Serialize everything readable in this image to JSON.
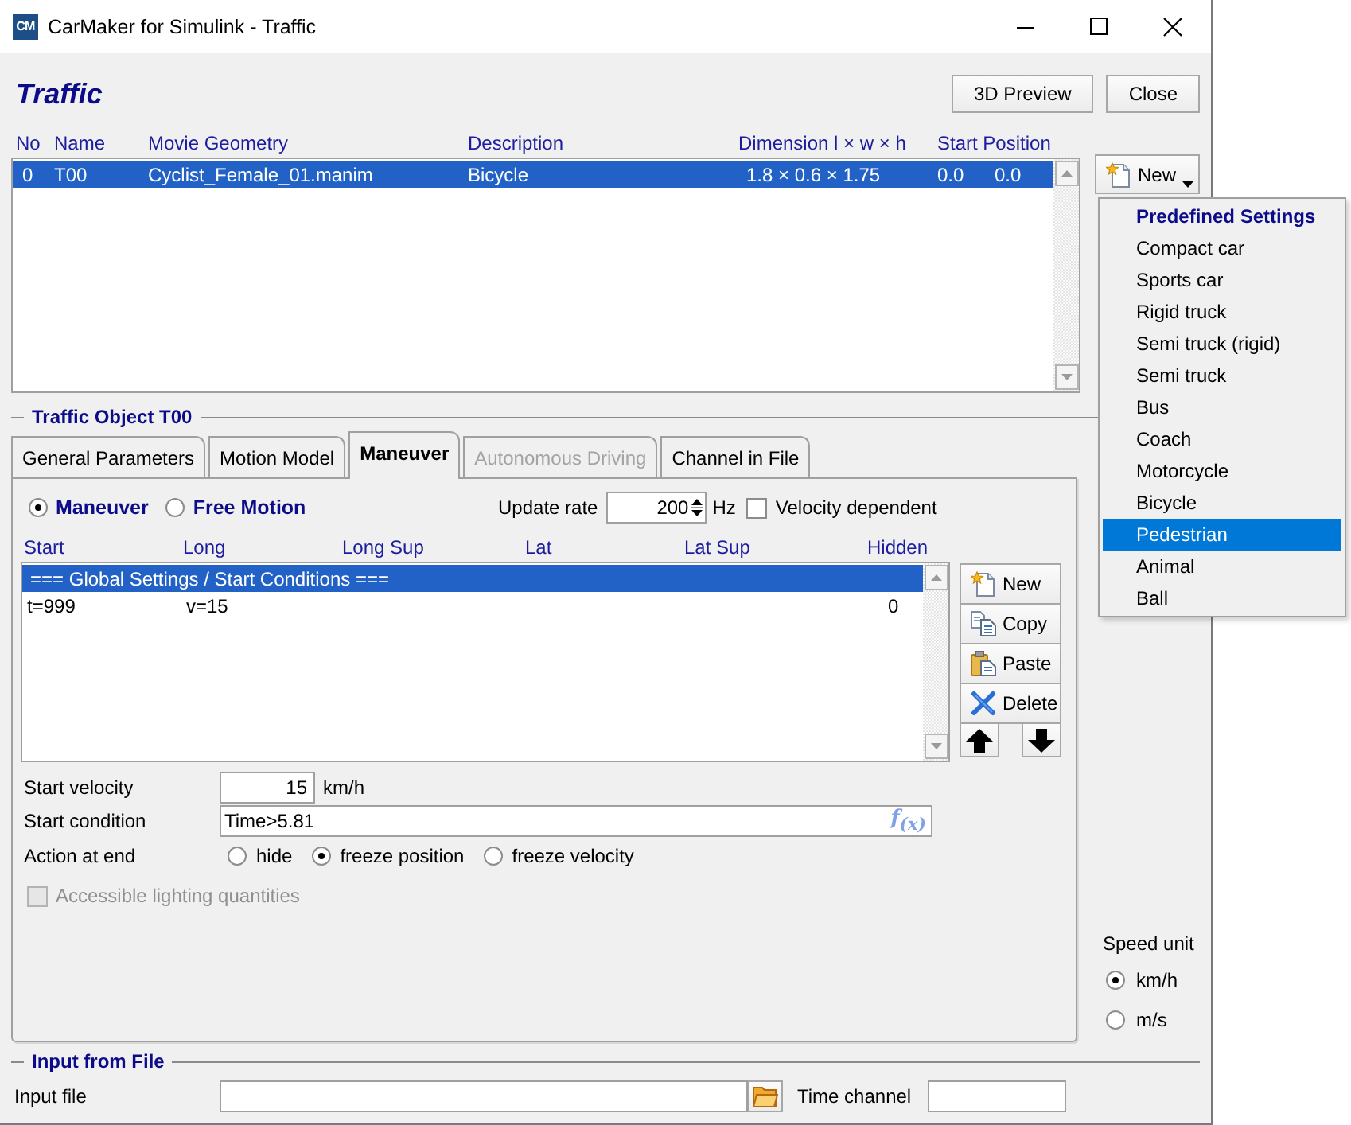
{
  "window": {
    "title": "CarMaker for Simulink - Traffic",
    "logo_text": "CM"
  },
  "header": {
    "title": "Traffic",
    "buttons": [
      {
        "label": "3D Preview"
      },
      {
        "label": "Close"
      }
    ]
  },
  "traffic_table": {
    "columns": [
      "No",
      "Name",
      "Movie Geometry",
      "Description",
      "Dimension l × w × h",
      "Start Position"
    ],
    "rows": [
      {
        "cells": [
          "0",
          "T00",
          "Cyclist_Female_01.manim",
          "Bicycle",
          "1.8 × 0.6 × 1.75",
          "0.0",
          "0.0"
        ],
        "selected": true
      }
    ]
  },
  "new_button": {
    "label": "New"
  },
  "new_menu": {
    "heading": "Predefined Settings",
    "items": [
      {
        "label": "Compact car",
        "selected": false
      },
      {
        "label": "Sports car",
        "selected": false
      },
      {
        "label": "Rigid truck",
        "selected": false
      },
      {
        "label": "Semi truck (rigid)",
        "selected": false
      },
      {
        "label": "Semi truck",
        "selected": false
      },
      {
        "label": "Bus",
        "selected": false
      },
      {
        "label": "Coach",
        "selected": false
      },
      {
        "label": "Motorcycle",
        "selected": false
      },
      {
        "label": "Bicycle",
        "selected": false
      },
      {
        "label": "Pedestrian",
        "selected": true
      },
      {
        "label": "Animal",
        "selected": false
      },
      {
        "label": "Ball",
        "selected": false
      }
    ]
  },
  "traffic_object": {
    "title": "Traffic Object T00",
    "tabs": [
      {
        "label": "General Parameters",
        "selected": false,
        "disabled": false
      },
      {
        "label": "Motion Model",
        "selected": false,
        "disabled": false
      },
      {
        "label": "Maneuver",
        "selected": true,
        "disabled": false
      },
      {
        "label": "Autonomous Driving",
        "selected": false,
        "disabled": true
      },
      {
        "label": "Channel in File",
        "selected": false,
        "disabled": false
      }
    ],
    "modes": [
      {
        "label": "Maneuver",
        "selected": true
      },
      {
        "label": "Free Motion",
        "selected": false
      }
    ],
    "update_rate": {
      "label": "Update rate",
      "value": "200",
      "unit": "Hz"
    },
    "velocity_dependent": {
      "label": "Velocity dependent",
      "checked": false
    },
    "maneuver_list": {
      "columns": {
        "start": "Start",
        "long": "Long",
        "long_sup": "Long Sup",
        "lat": "Lat",
        "lat_sup": "Lat Sup",
        "hidden": "Hidden"
      },
      "rows": [
        {
          "kind": "section",
          "text": "=== Global Settings / Start Conditions ===",
          "selected": true
        },
        {
          "kind": "step",
          "start": "t=999",
          "long": "v=15",
          "hidden": "0",
          "selected": false
        }
      ]
    },
    "list_buttons": [
      {
        "kind": "new",
        "label": "New"
      },
      {
        "kind": "copy",
        "label": "Copy"
      },
      {
        "kind": "paste",
        "label": "Paste"
      },
      {
        "kind": "delete",
        "label": "Delete"
      }
    ],
    "start_velocity": {
      "label": "Start velocity",
      "value": "15",
      "unit": "km/h"
    },
    "start_condition": {
      "label": "Start condition",
      "value": "Time>5.81",
      "formula_button": "f$_{(x)}$"
    },
    "action_at_end": {
      "label": "Action at end",
      "options": [
        {
          "label": "hide",
          "selected": false
        },
        {
          "label": "freeze position",
          "selected": true
        },
        {
          "label": "freeze velocity",
          "selected": false
        }
      ]
    },
    "lighting": {
      "label": "Accessible lighting quantities",
      "checked": false,
      "disabled": true
    }
  },
  "speed_unit": {
    "label": "Speed unit",
    "options": [
      {
        "label": "km/h",
        "selected": true
      },
      {
        "label": "m/s",
        "selected": false
      }
    ]
  },
  "input_from_file": {
    "title": "Input from File",
    "input_file": {
      "label": "Input file"
    },
    "time_channel": {
      "label": "Time channel"
    }
  }
}
